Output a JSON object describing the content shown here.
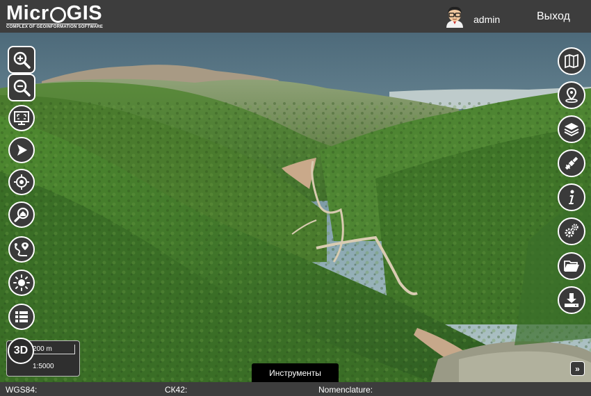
{
  "header": {
    "logo_part1": "Micr",
    "logo_part2": "GIS",
    "logo_subtitle": "COMPLEX OF GEOINFORMATION SOFTWARE",
    "user_name": "admin",
    "logout_label": "Выход"
  },
  "left_tools": [
    {
      "icon": "zoom-in-icon"
    },
    {
      "icon": "zoom-out-icon"
    },
    {
      "icon": "full-extent-icon"
    },
    {
      "icon": "navigation-arrow-icon"
    },
    {
      "icon": "locate-target-icon"
    },
    {
      "icon": "search-address-icon"
    },
    {
      "icon": "route-icon"
    },
    {
      "icon": "center-point-icon"
    },
    {
      "icon": "list-icon"
    }
  ],
  "right_tools": [
    {
      "icon": "map-icon"
    },
    {
      "icon": "location-pin-icon"
    },
    {
      "icon": "layers-icon"
    },
    {
      "icon": "satellite-icon"
    },
    {
      "icon": "info-icon"
    },
    {
      "icon": "settings-gears-icon"
    },
    {
      "icon": "folder-icon"
    },
    {
      "icon": "download-icon"
    }
  ],
  "scale": {
    "distance": "200 m",
    "ratio": "1:5000",
    "mode_3d": "3D"
  },
  "instruments_label": "Инструменты",
  "expand_label": "»",
  "status_bar": {
    "wgs84_label": "WGS84:",
    "ck42_label": "СК42:",
    "nomenclature_label": "Nomenclature:"
  },
  "colors": {
    "header_bg": "#3d3d3d",
    "tool_bg": "#3a3a3a",
    "tool_border": "#ffffff"
  }
}
